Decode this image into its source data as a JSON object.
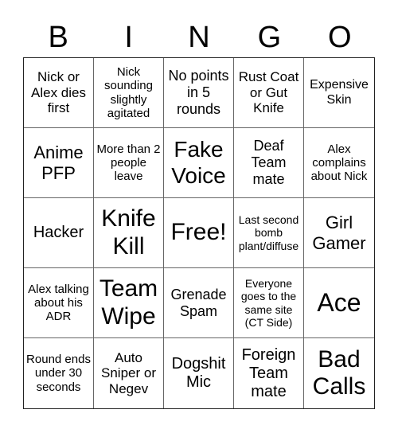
{
  "header": {
    "letters": [
      "B",
      "I",
      "N",
      "G",
      "O"
    ]
  },
  "cells": [
    "Nick or Alex dies first",
    "Nick sounding slightly agitated",
    "No points in 5 rounds",
    "Rust Coat or Gut Knife",
    "Expensive Skin",
    "Anime PFP",
    "More than 2 people leave",
    "Fake Voice",
    "Deaf Team mate",
    "Alex complains about Nick",
    "Hacker",
    "Knife Kill",
    "Free!",
    "Last second bomb plant/diffuse",
    "Girl Gamer",
    "Alex talking about his ADR",
    "Team Wipe",
    "Grenade Spam",
    "Everyone goes to the same site (CT Side)",
    "Ace",
    "Round ends under 30 seconds",
    "Auto Sniper or Negev",
    "Dogshit Mic",
    "Foreign Team mate",
    "Bad Calls"
  ]
}
